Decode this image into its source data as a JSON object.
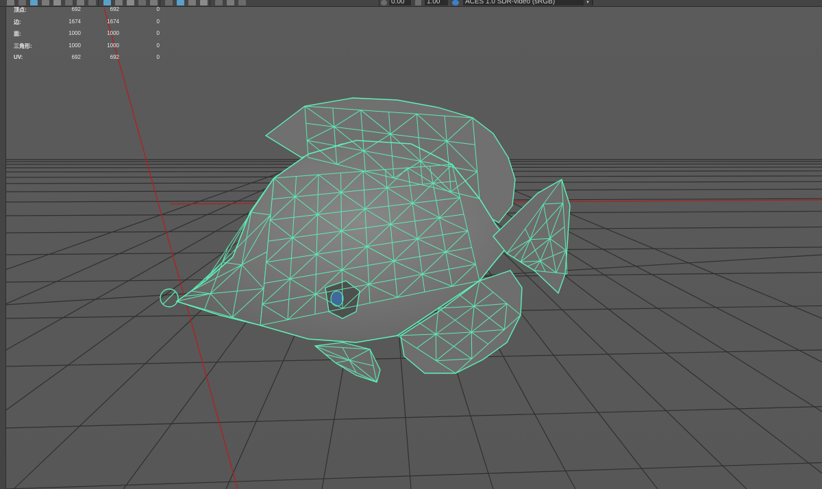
{
  "toolbar": {
    "exposure_value": "0.00",
    "gamma_value": "1.00",
    "color_space": "ACES 1.0 SDR-video (sRGB)",
    "icons": [
      "select-tool-icon",
      "lasso-icon",
      "paint-select-icon",
      "move-icon",
      "rotate-icon",
      "scale-icon",
      "universal-manip-icon",
      "soft-select-icon",
      "camera-icon",
      "grid-toggle-icon",
      "wireframe-icon",
      "smooth-shade-icon",
      "texture-icon",
      "light-icon",
      "shadow-icon",
      "isolate-icon",
      "xray-icon",
      "resolution-gate-icon",
      "film-gate-icon",
      "safe-action-icon",
      "exposure-icon",
      "gamma-icon",
      "color-management-icon"
    ]
  },
  "hud": {
    "rows": [
      {
        "label": "顶点:",
        "v1": "692",
        "v2": "692",
        "v3": "0"
      },
      {
        "label": "边:",
        "v1": "1674",
        "v2": "1674",
        "v3": "0"
      },
      {
        "label": "面:",
        "v1": "1000",
        "v2": "1000",
        "v3": "0"
      },
      {
        "label": "三角形:",
        "v1": "1000",
        "v2": "1000",
        "v3": "0"
      },
      {
        "label": "UV:",
        "v1": "692",
        "v2": "692",
        "v3": "0"
      }
    ]
  },
  "colors": {
    "background": "#595959",
    "grid": "#2f2f2f",
    "axis_red": "#b02020",
    "wireframe": "#5ef0b8",
    "mesh_fill": "#7a7a7a"
  }
}
